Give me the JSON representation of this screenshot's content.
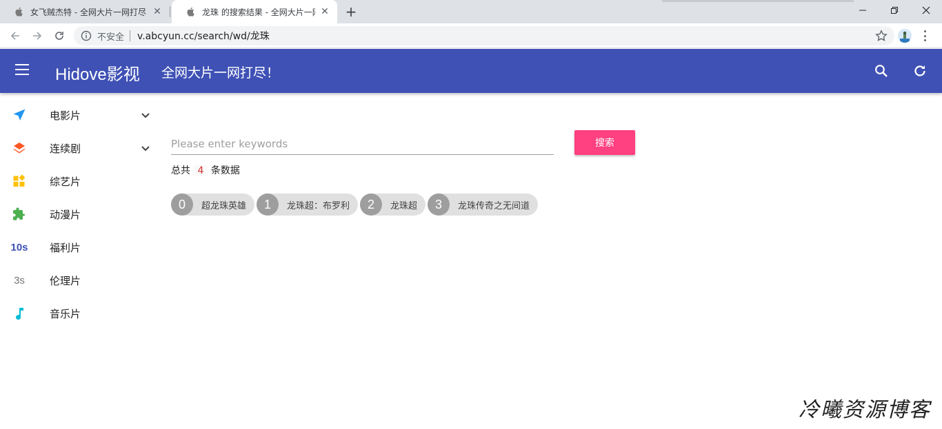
{
  "browser": {
    "tabs": [
      {
        "title": "女飞贼杰特 - 全网大片一网打尽！",
        "active": false
      },
      {
        "title": "龙珠 的搜索结果 - 全网大片一网打尽！",
        "active": true
      }
    ],
    "security_label": "不安全",
    "url": "v.abcyun.cc/search/wd/龙珠"
  },
  "header": {
    "brand": "Hidove影视",
    "slogan": "全网大片一网打尽！"
  },
  "sidebar": {
    "items": [
      {
        "label": "电影片",
        "icon": "send-icon",
        "expandable": true
      },
      {
        "label": "连续剧",
        "icon": "layers-icon",
        "expandable": true
      },
      {
        "label": "综艺片",
        "icon": "widgets-icon",
        "expandable": false
      },
      {
        "label": "动漫片",
        "icon": "puzzle-icon",
        "expandable": false
      },
      {
        "label": "福利片",
        "icon": "timer-10s-icon",
        "icon_text": "10s",
        "expandable": false
      },
      {
        "label": "伦理片",
        "icon": "timer-3s-icon",
        "icon_text": "3s",
        "expandable": false
      },
      {
        "label": "音乐片",
        "icon": "music-note-icon",
        "expandable": false
      }
    ]
  },
  "search": {
    "placeholder": "Please enter keywords",
    "value": "",
    "button_label": "搜索"
  },
  "results": {
    "total_prefix": "总共",
    "total_count": "4",
    "total_suffix": "条数据",
    "items": [
      {
        "index": "0",
        "title": "超龙珠英雄"
      },
      {
        "index": "1",
        "title": "龙珠超：布罗利"
      },
      {
        "index": "2",
        "title": "龙珠超"
      },
      {
        "index": "3",
        "title": "龙珠传奇之无间道"
      }
    ]
  },
  "watermark": "冷曦资源博客",
  "colors": {
    "appbar": "#3f51b5",
    "accent_button": "#ff4081",
    "chip_bg": "#e0e0e0",
    "chip_num_bg": "#9e9e9e",
    "count_text": "#d32f2f"
  }
}
